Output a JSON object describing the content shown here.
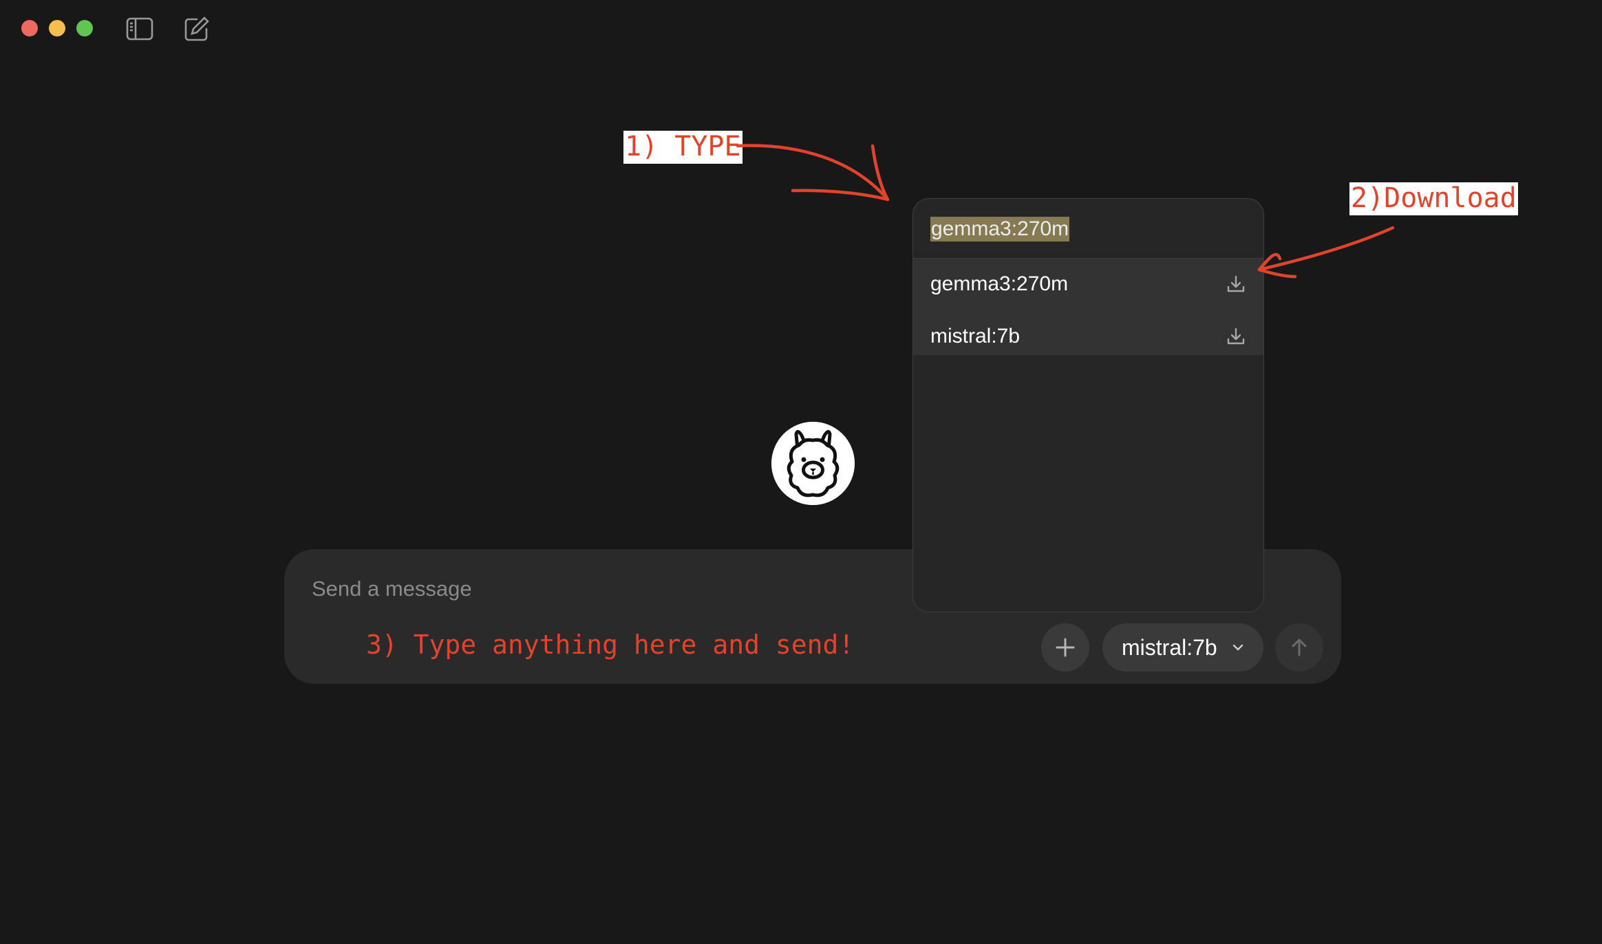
{
  "window": {
    "controls": [
      "close",
      "minimize",
      "maximize"
    ],
    "toolbar_icons": [
      "sidebar-toggle-icon",
      "new-chat-icon"
    ]
  },
  "logo": {
    "icon": "llama-icon"
  },
  "composer": {
    "placeholder": "Send a message",
    "value": "",
    "add_icon": "plus-icon",
    "send_icon": "arrow-up-icon",
    "model_selector": {
      "selected": "mistral:7b",
      "icon": "chevron-down-icon"
    }
  },
  "model_dropdown": {
    "search_value": "gemma3:270m",
    "items": [
      {
        "label": "gemma3:270m",
        "icon": "download-icon"
      },
      {
        "label": "mistral:7b",
        "icon": "download-icon"
      }
    ]
  },
  "annotations": {
    "step1": "1) TYPE",
    "step2": "2)Download",
    "step3": "3) Type anything here and send!",
    "color": "#e2432b"
  },
  "colors": {
    "background": "#181818",
    "composer": "#2a2a2a",
    "dropdown": "#262626",
    "search_highlight": "#857a52"
  }
}
